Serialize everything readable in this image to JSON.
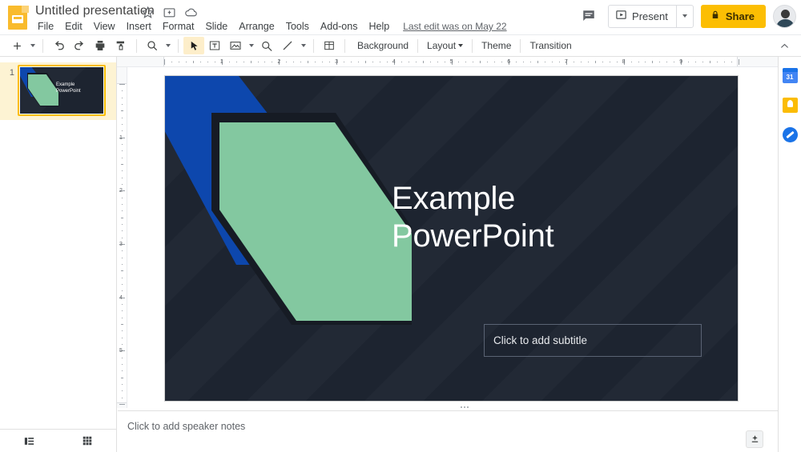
{
  "header": {
    "logo_icon": "slides-logo-icon",
    "doc_title": "Untitled presentation",
    "star_icon": "star-icon",
    "move_icon": "move-to-folder-icon",
    "cloud_icon": "cloud-saved-icon",
    "menus": [
      "File",
      "Edit",
      "View",
      "Insert",
      "Format",
      "Slide",
      "Arrange",
      "Tools",
      "Add-ons",
      "Help"
    ],
    "last_edit": "Last edit was on May 22",
    "comment_icon": "comment-icon",
    "present_label": "Present",
    "present_icon": "present-icon",
    "present_caret_icon": "chevron-down-icon",
    "share_label": "Share",
    "share_lock_icon": "lock-icon",
    "avatar_name": "account-avatar"
  },
  "toolbar": {
    "new_slide_icon": "plus-icon",
    "new_slide_caret_icon": "chevron-down-icon",
    "undo_icon": "undo-icon",
    "redo_icon": "redo-icon",
    "print_icon": "print-icon",
    "paint_format_icon": "paint-format-icon",
    "zoom_icon": "zoom-icon",
    "zoom_caret_icon": "chevron-down-icon",
    "select_icon": "select-cursor-icon",
    "textbox_icon": "text-box-icon",
    "image_icon": "insert-image-icon",
    "image_caret_icon": "chevron-down-icon",
    "shape_icon": "insert-shape-icon",
    "line_icon": "insert-line-icon",
    "line_caret_icon": "chevron-down-icon",
    "table_icon": "insert-table-icon",
    "background_label": "Background",
    "layout_label": "Layout",
    "layout_caret_icon": "chevron-down-icon",
    "theme_label": "Theme",
    "transition_label": "Transition",
    "collapse_icon": "chevron-up-icon"
  },
  "filmstrip": {
    "slides": [
      {
        "number": "1",
        "title_line1": "Example",
        "title_line2": "PowerPoint"
      }
    ]
  },
  "rulers": {
    "horizontal_ticks": [
      "1",
      "2",
      "3",
      "4",
      "5",
      "6",
      "7",
      "8",
      "9"
    ],
    "vertical_ticks": [
      "1",
      "2",
      "3",
      "4",
      "5"
    ]
  },
  "slide": {
    "title_line1": "Example",
    "title_line2": "PowerPoint",
    "subtitle_placeholder": "Click to add subtitle",
    "background_color": "#1d2430",
    "accent_blue": "#0d47ad",
    "accent_green": "#83c8a0",
    "title_color": "#ffffff"
  },
  "notes": {
    "placeholder": "Click to add speaker notes",
    "explore_icon": "explore-icon",
    "expand_icon": "chevron-right-icon"
  },
  "viewbar": {
    "filmstrip_view_icon": "filmstrip-view-icon",
    "grid_view_icon": "grid-view-icon"
  },
  "sidepanel": {
    "items": [
      {
        "name": "calendar-icon",
        "label": "31"
      },
      {
        "name": "keep-icon",
        "label": ""
      },
      {
        "name": "tasks-icon",
        "label": ""
      }
    ]
  }
}
